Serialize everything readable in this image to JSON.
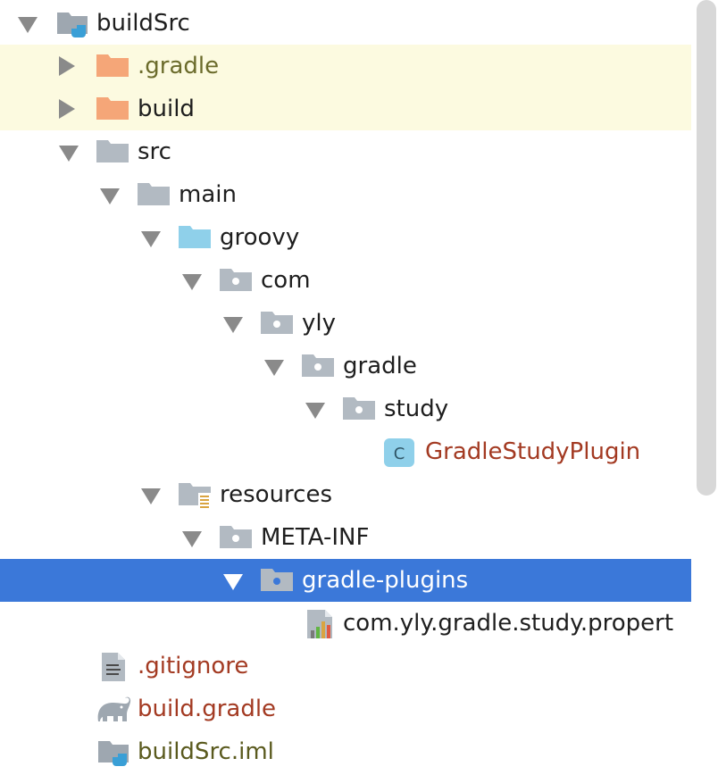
{
  "tree": {
    "items": [
      {
        "label": "buildSrc",
        "icon": "module-folder-icon"
      },
      {
        "label": ".gradle",
        "icon": "excluded-folder-icon"
      },
      {
        "label": "build",
        "icon": "excluded-folder-icon"
      },
      {
        "label": "src",
        "icon": "folder-icon"
      },
      {
        "label": "main",
        "icon": "folder-icon"
      },
      {
        "label": "groovy",
        "icon": "source-root-folder-icon"
      },
      {
        "label": "com",
        "icon": "package-icon"
      },
      {
        "label": "yly",
        "icon": "package-icon"
      },
      {
        "label": "gradle",
        "icon": "package-icon"
      },
      {
        "label": "study",
        "icon": "package-icon"
      },
      {
        "label": "GradleStudyPlugin",
        "icon": "groovy-class-icon",
        "badge": "C"
      },
      {
        "label": "resources",
        "icon": "resources-folder-icon"
      },
      {
        "label": "META-INF",
        "icon": "package-icon"
      },
      {
        "label": "gradle-plugins",
        "icon": "package-icon"
      },
      {
        "label": "com.yly.gradle.study.propert",
        "icon": "properties-file-icon"
      },
      {
        "label": ".gitignore",
        "icon": "text-file-icon"
      },
      {
        "label": "build.gradle",
        "icon": "gradle-elephant-icon"
      },
      {
        "label": "buildSrc.iml",
        "icon": "module-file-icon"
      }
    ]
  },
  "colors": {
    "selection": "#3b78d9",
    "excluded_bg": "#fcfae0",
    "excluded_folder": "#f5a678",
    "folder": "#b2bac2",
    "source_root": "#8fd0ea",
    "new_file_text": "#a33a22"
  }
}
